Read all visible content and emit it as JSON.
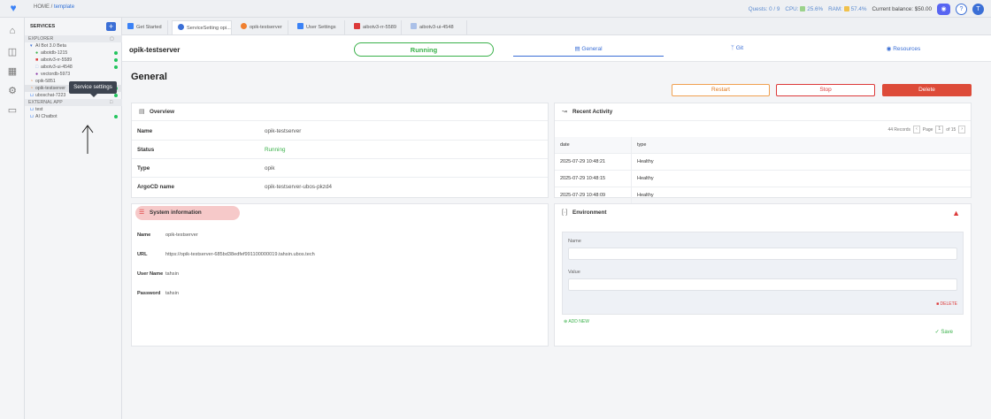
{
  "topbar": {
    "home": "HOME",
    "sep": "/",
    "crumb": "template",
    "quests": "Quests: 0 / 9",
    "cpu": "CPU:",
    "cpu_val": "25.6%",
    "ram": "RAM:",
    "ram_val": "57.4%",
    "balance": "Current balance: $50.00"
  },
  "sidebar": {
    "title": "SERVICES",
    "add": "+",
    "explorer": "EXPLORER",
    "project": "AI Bot 3.0 Beta",
    "items": [
      {
        "label": "aibotdb-1215"
      },
      {
        "label": "aibotv3-rr-5589"
      },
      {
        "label": "aibotv3-ui-4548"
      },
      {
        "label": "vectordb-5973"
      },
      {
        "label": "opik-5851"
      },
      {
        "label": "opik-testserver"
      },
      {
        "label": "uboschat-7223"
      }
    ],
    "external": "EXTERNAL APP",
    "ext_items": [
      {
        "label": "test"
      },
      {
        "label": "AI Chatbot"
      }
    ],
    "tooltip": "Service settings"
  },
  "tabs": [
    {
      "label": "Get Started",
      "color": "#3b82f6"
    },
    {
      "label": "ServiceSetting opi...",
      "color": "#3b6fd6"
    },
    {
      "label": "opik-testserver",
      "color": "#f08030"
    },
    {
      "label": "User Settings",
      "color": "#3b82f6"
    },
    {
      "label": "aibotv3-rr-5589",
      "color": "#dc3a3a"
    },
    {
      "label": "aibotv3-ui-4548",
      "color": "#aac0e8"
    }
  ],
  "header": {
    "service_name": "opik-testserver",
    "status": "Running",
    "tab_general": "General",
    "tab_git": "Git",
    "tab_resources": "Resources"
  },
  "page": {
    "title": "General",
    "restart": "Restart",
    "stop": "Stop",
    "delete": "Delete"
  },
  "overview": {
    "title": "Overview",
    "rows": [
      {
        "k": "Name",
        "v": "opik-testserver"
      },
      {
        "k": "Status",
        "v": "Running"
      },
      {
        "k": "Type",
        "v": "opik"
      },
      {
        "k": "ArgoCD name",
        "v": "opik-testserver-ubos-pkzd4"
      }
    ]
  },
  "sysinfo": {
    "title": "System information",
    "rows": [
      {
        "k": "Name",
        "v": "opik-testserver"
      },
      {
        "k": "URL",
        "v": "https://opik-testserver-685bd38edfef991100000019.tahsin.ubos.tech"
      },
      {
        "k": "User Name",
        "v": "tahsin"
      },
      {
        "k": "Password",
        "v": "tahsin"
      }
    ]
  },
  "activity": {
    "title": "Recent Activity",
    "records": "44 Records",
    "page_label": "Page",
    "page": "1",
    "of": "of 15",
    "headers": [
      "date",
      "type"
    ],
    "rows": [
      {
        "date": "2025-07-29 10:48:21",
        "type": "Healthy"
      },
      {
        "date": "2025-07-29 10:48:15",
        "type": "Healthy"
      },
      {
        "date": "2025-07-29 10:48:09",
        "type": "Healthy"
      }
    ]
  },
  "environment": {
    "title": "Environment",
    "name_label": "Name",
    "value_label": "Value",
    "delete": "DELETE",
    "add_new": "ADD NEW",
    "save": "Save"
  }
}
